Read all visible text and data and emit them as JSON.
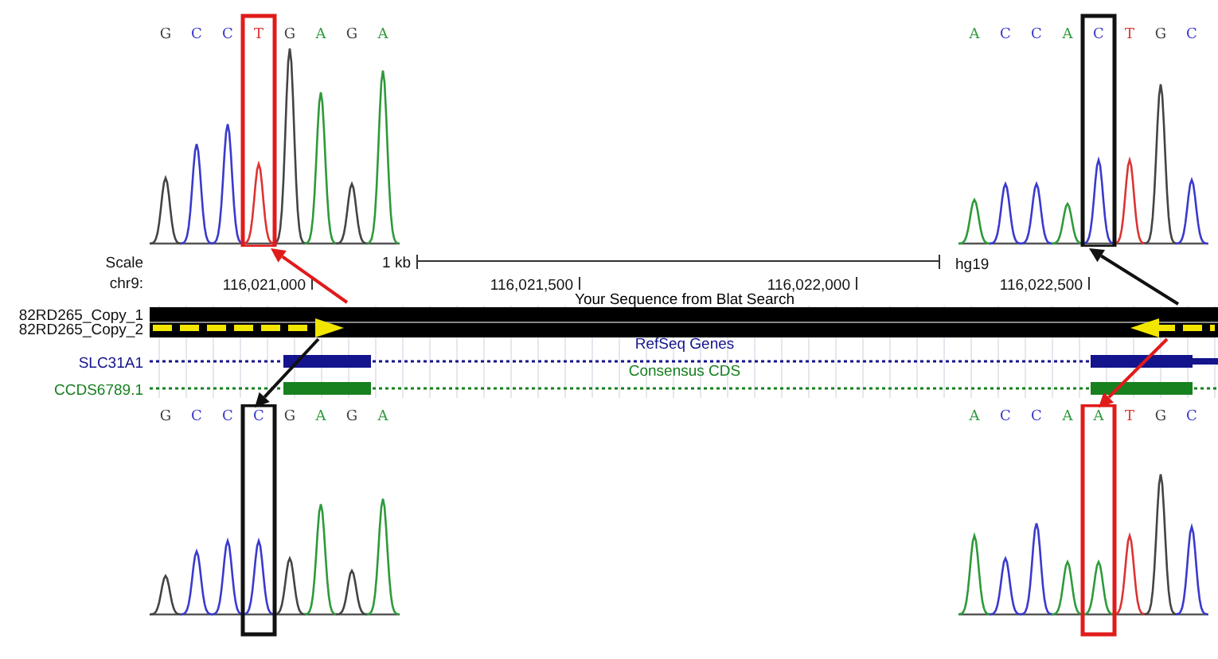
{
  "top_traces": [
    {
      "variant": true,
      "bases": [
        {
          "letter": "G",
          "color": "#444444",
          "boxed": false
        },
        {
          "letter": "C",
          "color": "#3a3acc",
          "boxed": false
        },
        {
          "letter": "C",
          "color": "#3a3acc",
          "boxed": false
        },
        {
          "letter": "T",
          "color": "#dd3333",
          "boxed": true
        },
        {
          "letter": "G",
          "color": "#444444",
          "boxed": false
        },
        {
          "letter": "A",
          "color": "#2e9a3a",
          "boxed": false
        },
        {
          "letter": "G",
          "color": "#444444",
          "boxed": false
        },
        {
          "letter": "A",
          "color": "#2e9a3a",
          "boxed": false
        }
      ]
    },
    {
      "variant": false,
      "bases": [
        {
          "letter": "A",
          "color": "#2e9a3a",
          "boxed": false
        },
        {
          "letter": "C",
          "color": "#3a3acc",
          "boxed": false
        },
        {
          "letter": "C",
          "color": "#3a3acc",
          "boxed": false
        },
        {
          "letter": "A",
          "color": "#2e9a3a",
          "boxed": false
        },
        {
          "letter": "C",
          "color": "#3a3acc",
          "boxed": true
        },
        {
          "letter": "T",
          "color": "#dd3333",
          "boxed": false
        },
        {
          "letter": "G",
          "color": "#444444",
          "boxed": false
        },
        {
          "letter": "C",
          "color": "#3a3acc",
          "boxed": false
        }
      ]
    }
  ],
  "browser": {
    "scale_label": "Scale",
    "scale": "1 kb",
    "assembly": "hg19",
    "chrom_label": "chr9:",
    "positions": [
      "116,021,000",
      "116,021,500",
      "116,022,000",
      "116,022,500"
    ],
    "tracks": [
      {
        "kind": "blat",
        "title": "Your Sequence from Blat Search",
        "color": "#000000",
        "rows": [
          "82RD265_Copy_1",
          "82RD265_Copy_2"
        ]
      },
      {
        "kind": "gene",
        "title": "RefSeq Genes",
        "color": "#14148c",
        "rows": [
          "SLC31A1"
        ]
      },
      {
        "kind": "cds",
        "title": "Consensus CDS",
        "color": "#17801f",
        "rows": [
          "CCDS6789.1"
        ]
      }
    ]
  },
  "bottom_traces": [
    {
      "variant": false,
      "bases": [
        {
          "letter": "G",
          "color": "#444444",
          "boxed": false
        },
        {
          "letter": "C",
          "color": "#3a3acc",
          "boxed": false
        },
        {
          "letter": "C",
          "color": "#3a3acc",
          "boxed": false
        },
        {
          "letter": "C",
          "color": "#3a3acc",
          "boxed": true
        },
        {
          "letter": "G",
          "color": "#444444",
          "boxed": false
        },
        {
          "letter": "A",
          "color": "#2e9a3a",
          "boxed": false
        },
        {
          "letter": "G",
          "color": "#444444",
          "boxed": false
        },
        {
          "letter": "A",
          "color": "#2e9a3a",
          "boxed": false
        }
      ]
    },
    {
      "variant": true,
      "bases": [
        {
          "letter": "A",
          "color": "#2e9a3a",
          "boxed": false
        },
        {
          "letter": "C",
          "color": "#3a3acc",
          "boxed": false
        },
        {
          "letter": "C",
          "color": "#3a3acc",
          "boxed": false
        },
        {
          "letter": "A",
          "color": "#2e9a3a",
          "boxed": false
        },
        {
          "letter": "A",
          "color": "#2e9a3a",
          "boxed": true
        },
        {
          "letter": "T",
          "color": "#dd3333",
          "boxed": false
        },
        {
          "letter": "G",
          "color": "#444444",
          "boxed": false
        },
        {
          "letter": "C",
          "color": "#3a3acc",
          "boxed": false
        }
      ]
    }
  ]
}
